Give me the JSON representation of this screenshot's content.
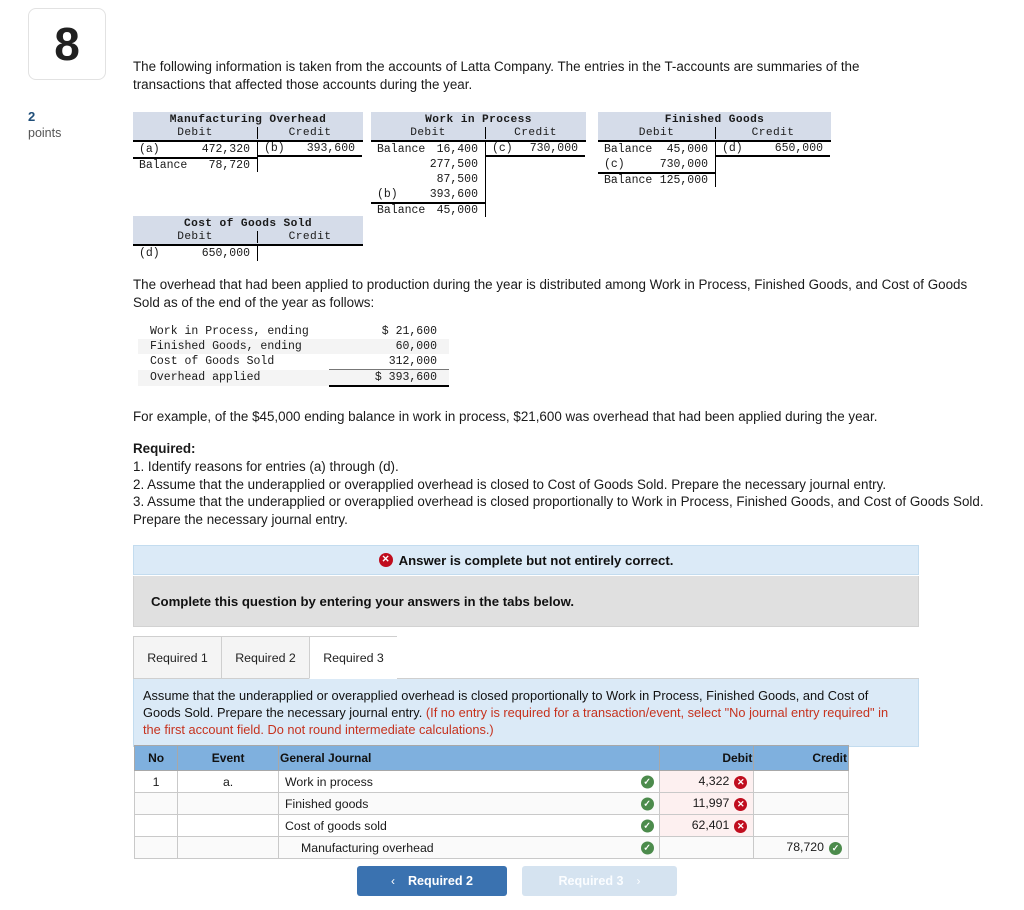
{
  "question": {
    "number": "8",
    "points_value": "2",
    "points_label": "points"
  },
  "intro": "The following information is taken from the accounts of Latta Company. The entries in the T-accounts are summaries of the transactions that affected those accounts during the year.",
  "distribution_text": "The overhead that had been applied to production during the year is distributed among Work in Process, Finished Goods, and Cost of Goods Sold as of the end of the year as follows:",
  "example_text": "For example, of the $45,000 ending balance in work in process, $21,600 was overhead that had been applied during the year.",
  "required": {
    "title": "Required:",
    "items": [
      "1. Identify reasons for entries (a) through (d).",
      "2. Assume that the underapplied or overapplied overhead is closed to Cost of Goods Sold. Prepare the necessary journal entry.",
      "3. Assume that the underapplied or overapplied overhead is closed proportionally to Work in Process, Finished Goods, and Cost of Goods Sold. Prepare the necessary journal entry."
    ]
  },
  "t_accounts": [
    {
      "id": "moh",
      "title": "Manufacturing Overhead",
      "debit_header": "Debit",
      "credit_header": "Credit",
      "debit_rows": [
        {
          "label": "(a)",
          "amount": "472,320"
        },
        {
          "label": "Balance",
          "amount": "78,720",
          "balance": true
        }
      ],
      "credit_rows": [
        {
          "label": "(b)",
          "amount": "393,600"
        }
      ]
    },
    {
      "id": "wip",
      "title": "Work in Process",
      "debit_header": "Debit",
      "credit_header": "Credit",
      "debit_rows": [
        {
          "label": "Balance",
          "amount": "16,400"
        },
        {
          "label": "",
          "amount": "277,500"
        },
        {
          "label": "",
          "amount": "87,500"
        },
        {
          "label": "(b)",
          "amount": "393,600"
        },
        {
          "label": "Balance",
          "amount": "45,000",
          "balance": true
        }
      ],
      "credit_rows": [
        {
          "label": "(c)",
          "amount": "730,000"
        }
      ]
    },
    {
      "id": "fg",
      "title": "Finished Goods",
      "debit_header": "Debit",
      "credit_header": "Credit",
      "debit_rows": [
        {
          "label": "Balance",
          "amount": "45,000"
        },
        {
          "label": "(c)",
          "amount": "730,000"
        },
        {
          "label": "Balance",
          "amount": "125,000",
          "balance": true
        }
      ],
      "credit_rows": [
        {
          "label": "(d)",
          "amount": "650,000"
        }
      ]
    },
    {
      "id": "cogs",
      "title": "Cost of Goods Sold",
      "debit_header": "Debit",
      "credit_header": "Credit",
      "debit_rows": [
        {
          "label": "(d)",
          "amount": "650,000"
        }
      ],
      "credit_rows": []
    }
  ],
  "overhead_table": {
    "rows": [
      {
        "name": "Work in Process, ending",
        "value": "$ 21,600"
      },
      {
        "name": "Finished Goods, ending",
        "value": "60,000"
      },
      {
        "name": "Cost of Goods Sold",
        "value": "312,000"
      },
      {
        "name": "Overhead applied",
        "value": "$ 393,600"
      }
    ]
  },
  "answer_banner": {
    "text": "Answer is complete but not entirely correct.",
    "icon": "x-circle-icon"
  },
  "complete_bar": {
    "text": "Complete this question by entering your answers in the tabs below."
  },
  "tabs": [
    {
      "label": "Required 1",
      "active": false
    },
    {
      "label": "Required 2",
      "active": false
    },
    {
      "label": "Required 3",
      "active": true
    }
  ],
  "tab_instruction": {
    "black_text": "Assume that the underapplied or overapplied overhead is closed proportionally to Work in Process, Finished Goods, and Cost of Goods Sold. Prepare the necessary journal entry. ",
    "red_text": "(If no entry is required for a transaction/event, select \"No journal entry required\" in the first account field. Do not round intermediate calculations.)"
  },
  "journal": {
    "headers": [
      "No",
      "Event",
      "General Journal",
      "Debit",
      "Credit"
    ],
    "rows": [
      {
        "no": "1",
        "event": "a.",
        "account": "Work in process",
        "indent": false,
        "account_mark": "ok",
        "debit": "4,322",
        "debit_mark": "bad",
        "credit": "",
        "credit_mark": ""
      },
      {
        "no": "",
        "event": "",
        "account": "Finished goods",
        "indent": false,
        "account_mark": "ok",
        "debit": "11,997",
        "debit_mark": "bad",
        "credit": "",
        "credit_mark": ""
      },
      {
        "no": "",
        "event": "",
        "account": "Cost of goods sold",
        "indent": false,
        "account_mark": "ok",
        "debit": "62,401",
        "debit_mark": "bad",
        "credit": "",
        "credit_mark": ""
      },
      {
        "no": "",
        "event": "",
        "account": "Manufacturing overhead",
        "indent": true,
        "account_mark": "ok",
        "debit": "",
        "debit_mark": "",
        "credit": "78,720",
        "credit_mark": "ok"
      }
    ]
  },
  "nav": {
    "prev_label": "Required 2",
    "next_label": "Required 3",
    "prev_chevron": "‹",
    "next_chevron": "›"
  },
  "colors": {
    "accent_blue": "#3a72b0",
    "banner_blue": "#dbeaf7",
    "table_header_blue": "#7fb0de",
    "error_red": "#c00d1e",
    "success_green": "#4c8b4c",
    "t_header_bg": "#d5dce9"
  }
}
